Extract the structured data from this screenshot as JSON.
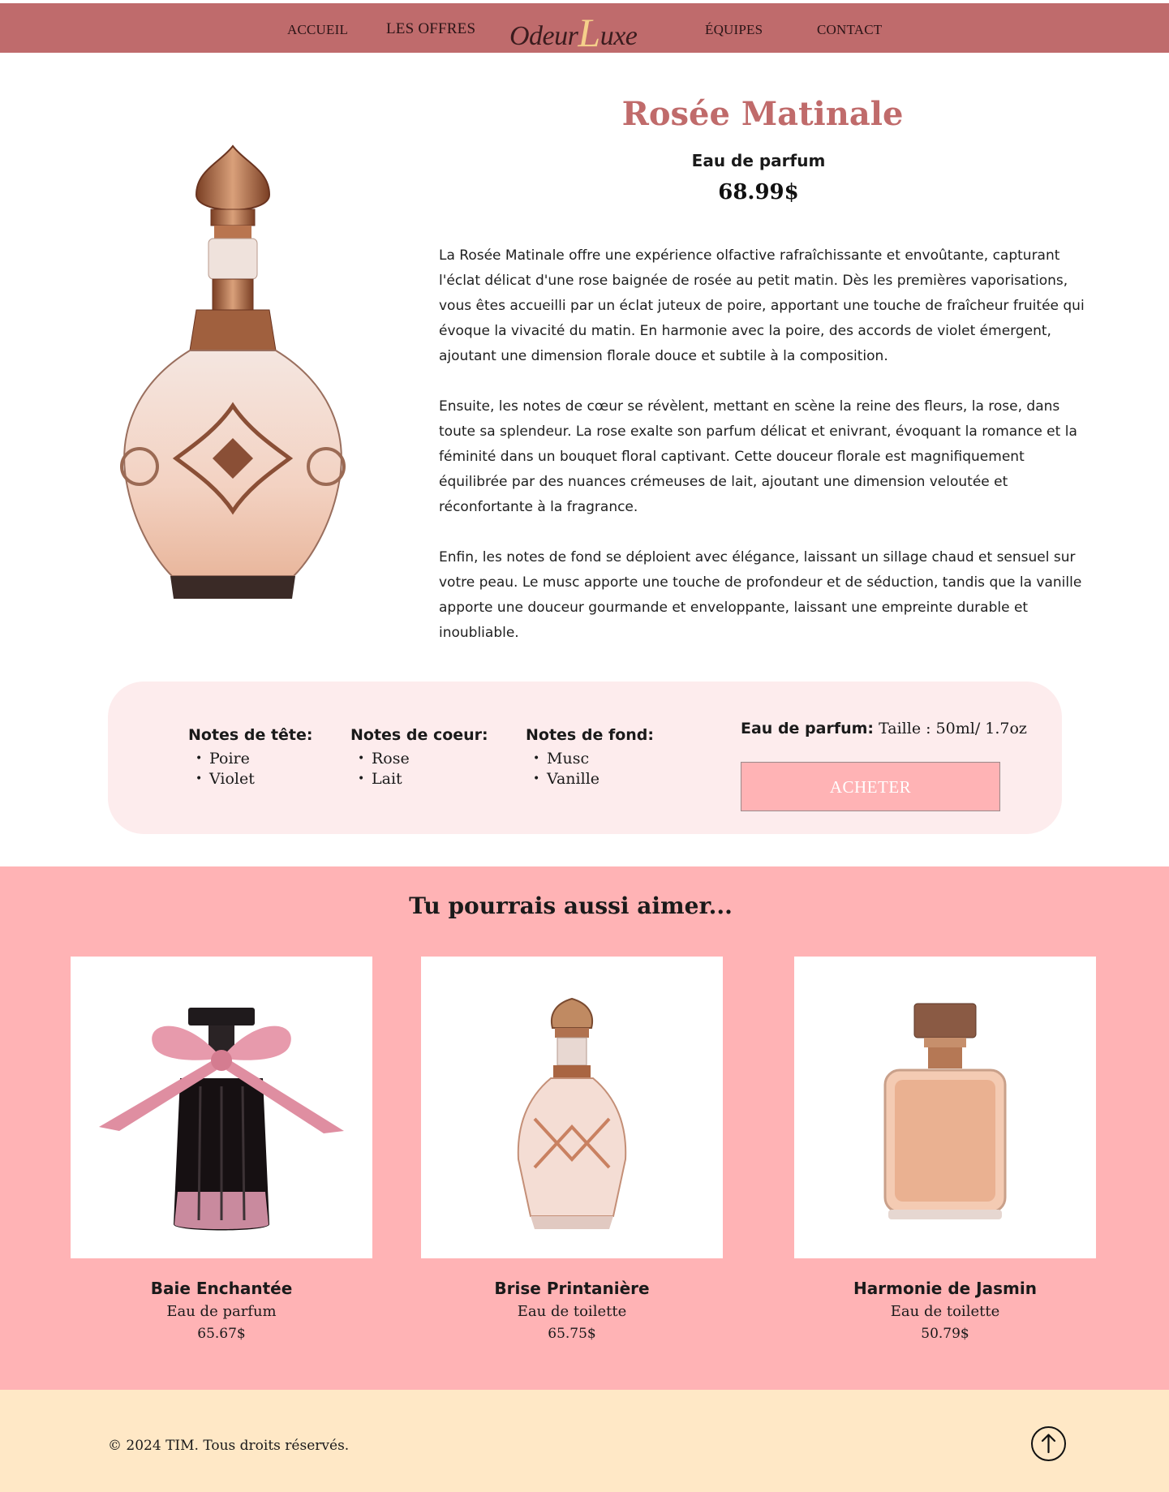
{
  "nav": {
    "home": "ACCUEIL",
    "offers": "LES OFFRES",
    "logo_part1": "Odeur",
    "logo_part2": "L",
    "logo_part3": "uxe",
    "teams": "ÉQUIPES",
    "contact": "CONTACT"
  },
  "product": {
    "title": "Rosée Matinale",
    "type": "Eau de parfum",
    "price": "68.99$",
    "description": [
      "La Rosée Matinale offre une expérience olfactive rafraîchissante et envoûtante, capturant l'éclat délicat d'une rose baignée de rosée au petit matin. Dès les premières vaporisations, vous êtes accueilli par un éclat juteux de poire, apportant une touche de fraîcheur fruitée qui évoque la vivacité du matin. En harmonie avec la poire, des accords de violet émergent, ajoutant une dimension florale douce et subtile à la composition.",
      "Ensuite, les notes de cœur se révèlent, mettant en scène la reine des fleurs, la rose, dans toute sa splendeur. La rose exalte son parfum délicat et enivrant, évoquant la romance et la féminité dans un bouquet floral captivant. Cette douceur florale est magnifiquement équilibrée par des nuances crémeuses de lait, ajoutant une dimension veloutée et réconfortante à la fragrance.",
      "Enfin, les notes de fond se déploient avec élégance, laissant un sillage chaud et sensuel sur votre peau. Le musc apporte une touche de profondeur et de séduction, tandis que la vanille apporte une douceur gourmande et enveloppante, laissant une empreinte durable et inoubliable."
    ]
  },
  "notes": {
    "top": {
      "title": "Notes de tête:",
      "items": [
        "Poire",
        "Violet"
      ]
    },
    "heart": {
      "title": "Notes de coeur:",
      "items": [
        "Rose",
        "Lait"
      ]
    },
    "base": {
      "title": "Notes de fond:",
      "items": [
        "Musc",
        "Vanille"
      ]
    }
  },
  "buy": {
    "label": "Eau de parfum:",
    "size": "Taille : 50ml/ 1.7oz",
    "button": "ACHETER"
  },
  "related": {
    "title": "Tu pourrais aussi aimer...",
    "items": [
      {
        "name": "Baie Enchantée",
        "type": "Eau de parfum",
        "price": "65.67$"
      },
      {
        "name": "Brise Printanière",
        "type": "Eau de toilette",
        "price": "65.75$"
      },
      {
        "name": "Harmonie de Jasmin",
        "type": "Eau de toilette",
        "price": "50.79$"
      }
    ]
  },
  "footer": {
    "copyright": "© 2024 TIM. Tous droits réservés."
  },
  "colors": {
    "nav_bg": "#bf6b6c",
    "title": "#c06b6b",
    "panel_bg": "#fdeced",
    "related_bg": "#ffb3b5",
    "footer_bg": "#ffe8c6",
    "logo_accent": "#f5d08a"
  },
  "icons": {
    "scroll_top": "arrow-up-circle-icon"
  }
}
